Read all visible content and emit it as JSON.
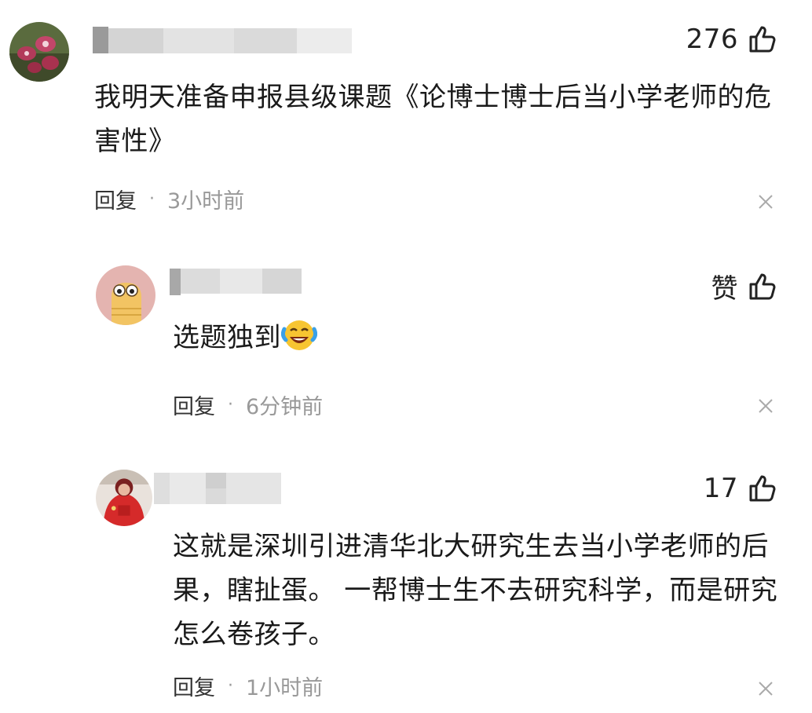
{
  "comments": [
    {
      "avatar": "orchid-flower-avatar",
      "likes": "276",
      "text": "我明天准备申报县级课题《论博士博士后当小学老师的危害性》",
      "reply_label": "回复",
      "separator": "·",
      "time": "3小时前"
    },
    {
      "avatar": "cartoon-character-avatar",
      "likes": "赞",
      "text": "选题独到",
      "emoji": "laughing-crying-emoji",
      "reply_label": "回复",
      "separator": "·",
      "time": "6分钟前"
    },
    {
      "avatar": "child-in-red-avatar",
      "likes": "17",
      "text": "这就是深圳引进清华北大研究生去当小学老师的后果，瞎扯蛋。 一帮博士生不去研究科学，而是研究怎么卷孩子。",
      "reply_label": "回复",
      "separator": "·",
      "time": "1小时前"
    }
  ],
  "icons": {
    "like": "thumbs-up-icon",
    "close": "close-icon"
  },
  "colors": {
    "text": "#1a1a1a",
    "meta": "#999999",
    "emoji_face": "#f7c531"
  }
}
